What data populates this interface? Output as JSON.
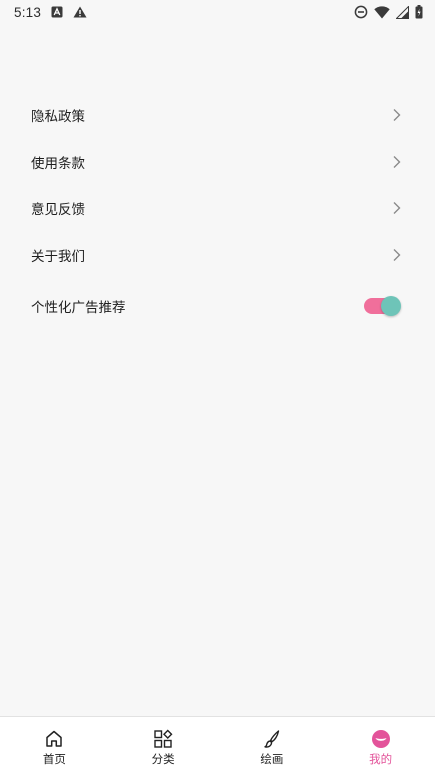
{
  "status_bar": {
    "time": "5:13",
    "icons_left": [
      "a-box-icon",
      "warning-icon"
    ],
    "icons_right": [
      "do-not-disturb-icon",
      "wifi-icon",
      "signal-icon",
      "battery-icon"
    ]
  },
  "settings": {
    "items": [
      {
        "label": "隐私政策"
      },
      {
        "label": "使用条款"
      },
      {
        "label": "意见反馈"
      },
      {
        "label": "关于我们"
      }
    ],
    "toggle_item": {
      "label": "个性化广告推荐",
      "enabled": true
    }
  },
  "bottom_nav": {
    "items": [
      {
        "label": "首页",
        "icon": "home-icon"
      },
      {
        "label": "分类",
        "icon": "category-icon"
      },
      {
        "label": "绘画",
        "icon": "brush-icon"
      },
      {
        "label": "我的",
        "icon": "profile-icon",
        "active": true
      }
    ]
  },
  "colors": {
    "accent": "#e3539a",
    "toggle_track": "#f06f9b",
    "toggle_thumb": "#6ec4b8",
    "background": "#f7f7f7"
  }
}
